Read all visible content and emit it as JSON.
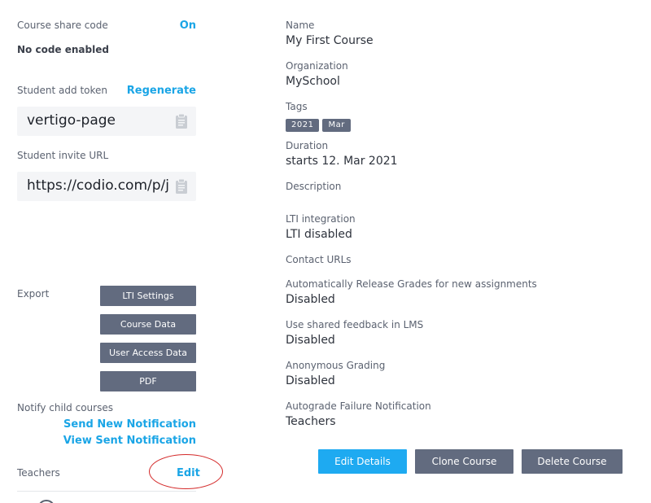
{
  "left": {
    "share_code": {
      "label": "Course share code",
      "toggle": "On",
      "status": "No code enabled"
    },
    "add_token": {
      "label": "Student add token",
      "action": "Regenerate",
      "value": "vertigo-page"
    },
    "invite_url": {
      "label": "Student invite URL",
      "value": "https://codio.com/p/join/vertigo-page"
    },
    "export": {
      "label": "Export",
      "buttons": [
        "LTI Settings",
        "Course Data",
        "User Access Data",
        "PDF"
      ]
    },
    "notify": {
      "label": "Notify child courses",
      "send": "Send New Notification",
      "view": "View Sent Notification"
    },
    "teachers": {
      "label": "Teachers",
      "edit": "Edit"
    }
  },
  "details": {
    "name": {
      "label": "Name",
      "value": "My First Course"
    },
    "organization": {
      "label": "Organization",
      "value": "MySchool"
    },
    "tags": {
      "label": "Tags",
      "items": [
        "2021",
        "Mar"
      ]
    },
    "duration": {
      "label": "Duration",
      "value": "starts 12. Mar 2021"
    },
    "description": {
      "label": "Description"
    },
    "lti": {
      "label": "LTI integration",
      "value": "LTI disabled"
    },
    "contact": {
      "label": "Contact URLs"
    },
    "auto_release": {
      "label": "Automatically Release Grades for new assignments",
      "value": "Disabled"
    },
    "shared_feedback": {
      "label": "Use shared feedback in LMS",
      "value": "Disabled"
    },
    "anonymous": {
      "label": "Anonymous Grading",
      "value": "Disabled"
    },
    "autograde_fail": {
      "label": "Autograde Failure Notification",
      "value": "Teachers"
    }
  },
  "actions": {
    "edit": "Edit Details",
    "clone": "Clone Course",
    "delete": "Delete Course"
  },
  "colors": {
    "primary_button": "#1eaaf1",
    "secondary_button": "#626b7f",
    "link": "#1aa5e6",
    "highlight": "#d42a2a"
  },
  "icons": {
    "copy": "clipboard-icon"
  }
}
